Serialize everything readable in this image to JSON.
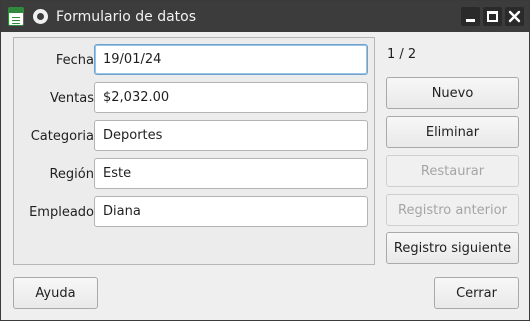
{
  "window": {
    "title": "Formulario de datos",
    "app_icon": "spreadsheet-icon",
    "menu_icon": "window-menu-icon",
    "controls": [
      "minimize-icon",
      "maximize-icon",
      "close-icon"
    ]
  },
  "form": {
    "fields": [
      {
        "label": "Fecha",
        "value": "19/01/24"
      },
      {
        "label": "Ventas",
        "value": "$2,032.00"
      },
      {
        "label": "Categoria",
        "value": "Deportes"
      },
      {
        "label": "Región",
        "value": "Este"
      },
      {
        "label": "Empleado",
        "value": "Diana"
      }
    ],
    "record_counter": "1 / 2"
  },
  "actions": {
    "new": "Nuevo",
    "delete": "Eliminar",
    "restore": "Restaurar",
    "previous": "Registro anterior",
    "next": "Registro siguiente"
  },
  "footer": {
    "help": "Ayuda",
    "close": "Cerrar"
  }
}
